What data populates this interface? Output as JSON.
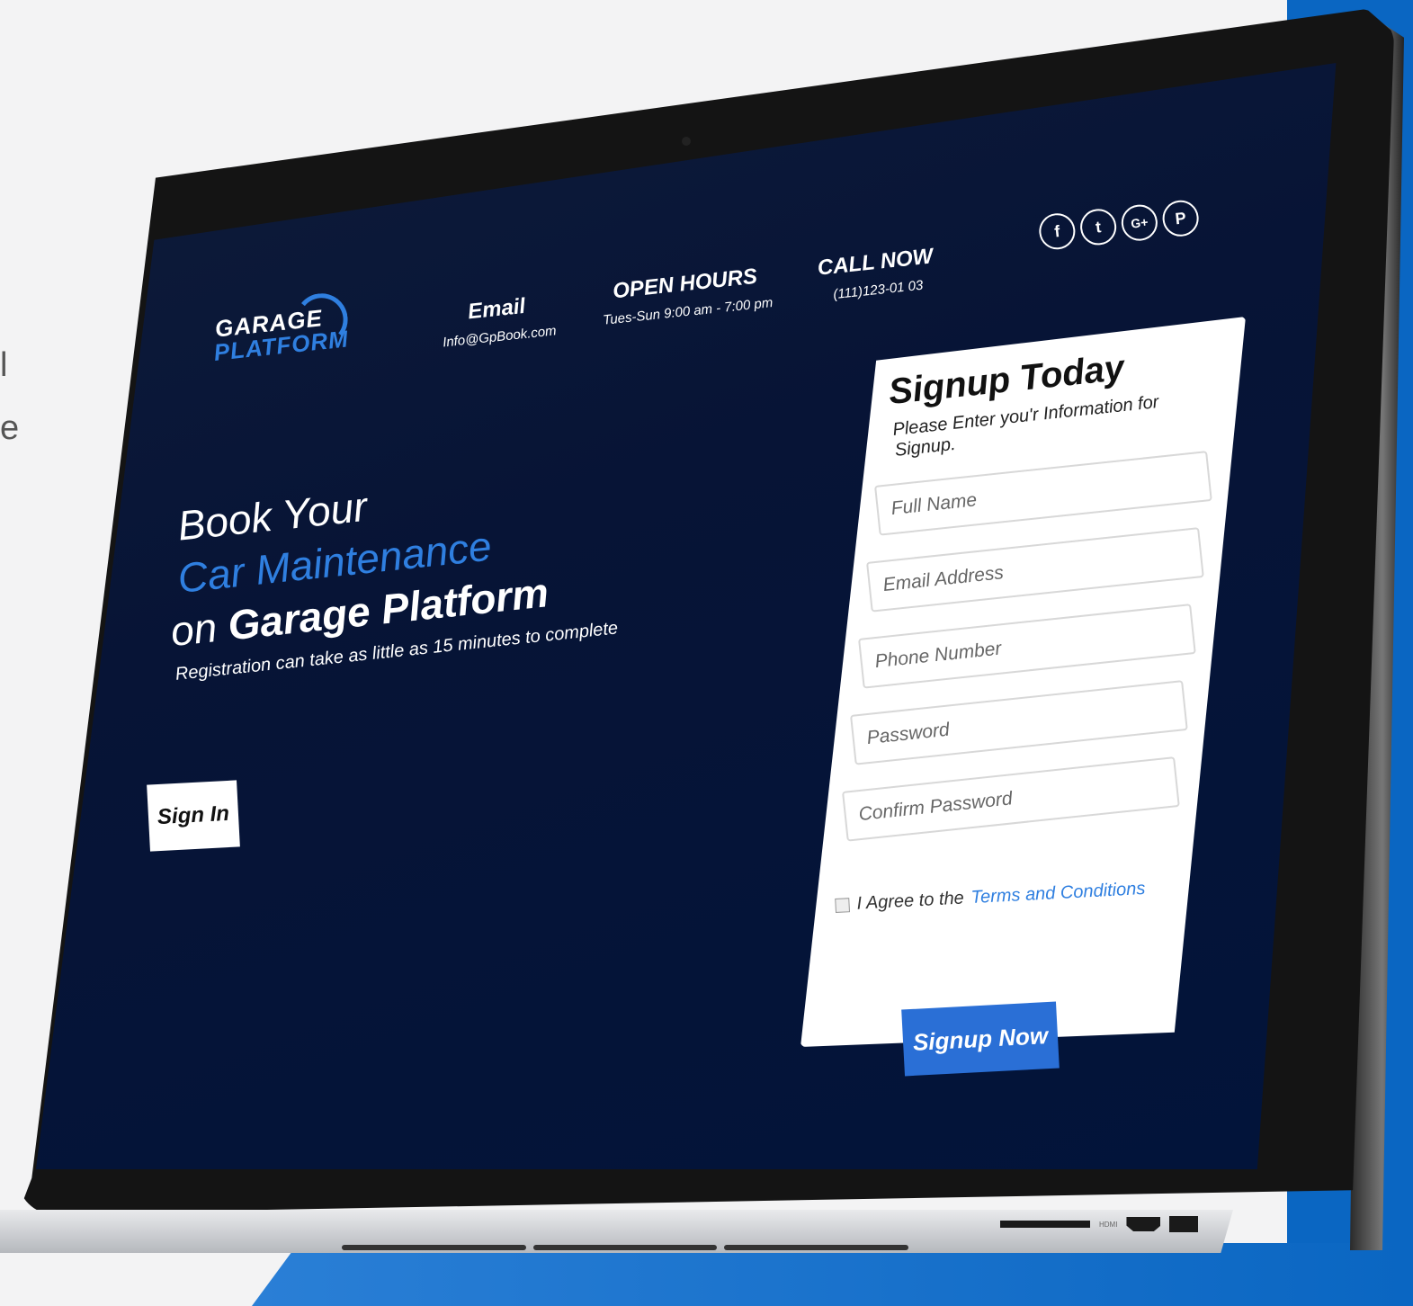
{
  "side": {
    "line1": "l",
    "line2": "e"
  },
  "logo": {
    "line1": "GARAGE",
    "line2": "PLATFORM"
  },
  "header": {
    "email": {
      "label": "Email",
      "value": "Info@GpBook.com"
    },
    "hours": {
      "label": "OPEN HOURS",
      "value": "Tues-Sun 9:00 am - 7:00 pm"
    },
    "call": {
      "label": "CALL NOW",
      "value": "(111)123-01 03"
    },
    "social": [
      {
        "name": "facebook-icon",
        "glyph": "f"
      },
      {
        "name": "twitter-icon",
        "glyph": "t"
      },
      {
        "name": "google-plus-icon",
        "glyph": "G+"
      },
      {
        "name": "pinterest-icon",
        "glyph": "P"
      }
    ]
  },
  "hero": {
    "line1": "Book Your",
    "line2": "Car Maintenance",
    "line3_prefix": "on ",
    "line3_bold": "Garage Platform",
    "subtitle": "Registration can take as little as 15 minutes to complete",
    "signin_label": "Sign In"
  },
  "signup": {
    "title": "Signup Today",
    "subtitle": "Please Enter you'r Information for Signup.",
    "fields": {
      "full_name": "Full Name",
      "email": "Email Address",
      "phone": "Phone Number",
      "password": "Password",
      "confirm": "Confirm Password"
    },
    "agree_text": "I Agree to the ",
    "terms_link": "Terms and Conditions",
    "button": "Signup Now"
  },
  "ports": {
    "hdmi_label": "HDMI"
  },
  "colors": {
    "accent": "#2f7fe0",
    "background_blue": "#0a66c2",
    "screen_bg": "#02143a"
  }
}
